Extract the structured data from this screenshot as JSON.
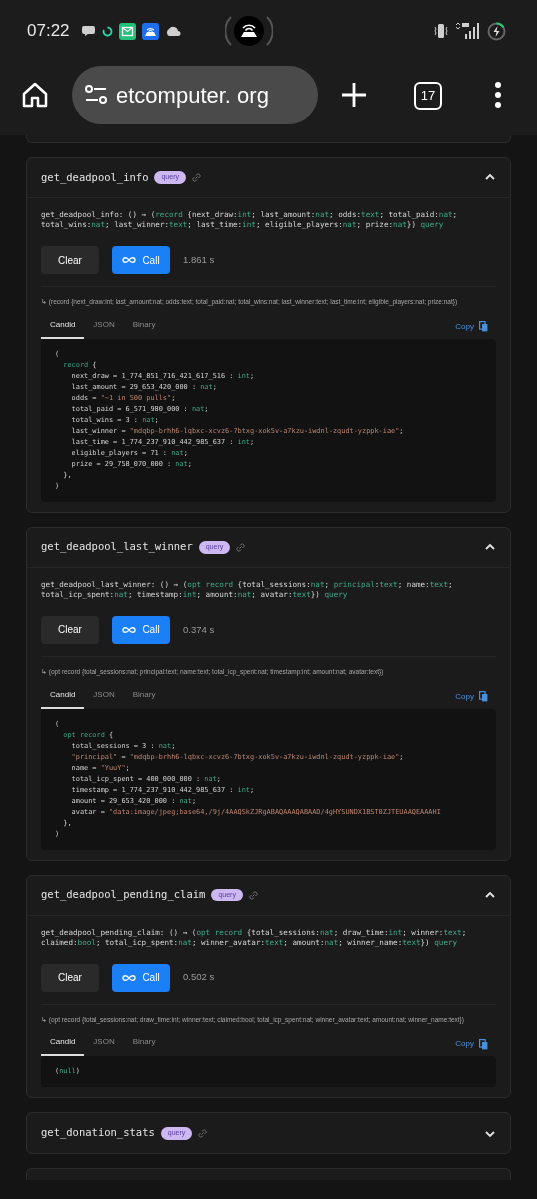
{
  "status_bar": {
    "time": "07:22"
  },
  "browser": {
    "url": "etcomputer. org",
    "tab_count": "17"
  },
  "methods": [
    {
      "name": "get_deadpool_info",
      "badge": "query",
      "expanded": true,
      "signature": [
        [
          {
            "text": "get_deadpool_info: () → (",
            "kind": "plain"
          },
          {
            "text": "record",
            "kind": "type"
          },
          {
            "text": " {next_draw:",
            "kind": "plain"
          },
          {
            "text": "int",
            "kind": "type"
          },
          {
            "text": "; last_amount:",
            "kind": "plain"
          },
          {
            "text": "nat",
            "kind": "type"
          },
          {
            "text": "; odds:",
            "kind": "plain"
          },
          {
            "text": "text",
            "kind": "type"
          },
          {
            "text": "; total_paid:",
            "kind": "plain"
          },
          {
            "text": "nat",
            "kind": "type"
          },
          {
            "text": ";",
            "kind": "plain"
          }
        ],
        [
          {
            "text": "total_wins:",
            "kind": "plain"
          },
          {
            "text": "nat",
            "kind": "type"
          },
          {
            "text": "; last_winner:",
            "kind": "plain"
          },
          {
            "text": "text",
            "kind": "type"
          },
          {
            "text": "; last_time:",
            "kind": "plain"
          },
          {
            "text": "int",
            "kind": "type"
          },
          {
            "text": "; eligible_players:",
            "kind": "plain"
          },
          {
            "text": "nat",
            "kind": "type"
          },
          {
            "text": "; prize:",
            "kind": "plain"
          },
          {
            "text": "nat",
            "kind": "type"
          },
          {
            "text": "}) ",
            "kind": "plain"
          },
          {
            "text": "query",
            "kind": "type"
          }
        ]
      ],
      "clear_button": "Clear",
      "call_button": "Call",
      "duration": "1.861 s",
      "return_type": "↳ (record {next_draw:int; last_amount:nat; odds:text; total_paid:nat; total_wins:nat; last_winner:text; last_time:int; eligible_players:nat; prize:nat})",
      "tabs": [
        {
          "label": "Candid",
          "selected": true
        },
        {
          "label": "JSON",
          "selected": false
        },
        {
          "label": "Binary",
          "selected": false
        }
      ],
      "copy": "Copy",
      "result": [
        [
          {
            "text": "(",
            "kind": "plain"
          }
        ],
        [
          {
            "text": "  record",
            "kind": "type"
          },
          {
            "text": " {",
            "kind": "plain"
          }
        ],
        [
          {
            "text": "    next_draw = 1_774_851_716_421_617_516 : ",
            "kind": "plain"
          },
          {
            "text": "int",
            "kind": "type"
          },
          {
            "text": ";",
            "kind": "plain"
          }
        ],
        [
          {
            "text": "    last_amount = 29_653_420_000 : ",
            "kind": "plain"
          },
          {
            "text": "nat",
            "kind": "type"
          },
          {
            "text": ";",
            "kind": "plain"
          }
        ],
        [
          {
            "text": "    odds = ",
            "kind": "plain"
          },
          {
            "text": "\"~1 in 500 pulls\"",
            "kind": "string"
          },
          {
            "text": ";",
            "kind": "plain"
          }
        ],
        [
          {
            "text": "    total_paid = 6_571_980_000 : ",
            "kind": "plain"
          },
          {
            "text": "nat",
            "kind": "type"
          },
          {
            "text": ";",
            "kind": "plain"
          }
        ],
        [
          {
            "text": "    total_wins = 3 : ",
            "kind": "plain"
          },
          {
            "text": "nat",
            "kind": "type"
          },
          {
            "text": ";",
            "kind": "plain"
          }
        ],
        [
          {
            "text": "    last_winner = ",
            "kind": "plain"
          },
          {
            "text": "\"mdqbp-brhh6-lqbxc-xcvz6-7btxg-xok5v-a7kzu-iwdnl-zqudt-yzppk-iae\"",
            "kind": "string"
          },
          {
            "text": ";",
            "kind": "plain"
          }
        ],
        [
          {
            "text": "    last_time = 1_774_237_910_442_985_637 : ",
            "kind": "plain"
          },
          {
            "text": "int",
            "kind": "type"
          },
          {
            "text": ";",
            "kind": "plain"
          }
        ],
        [
          {
            "text": "    eligible_players = 71 : ",
            "kind": "plain"
          },
          {
            "text": "nat",
            "kind": "type"
          },
          {
            "text": ";",
            "kind": "plain"
          }
        ],
        [
          {
            "text": "    prize = 29_758_070_000 : ",
            "kind": "plain"
          },
          {
            "text": "nat",
            "kind": "type"
          },
          {
            "text": ";",
            "kind": "plain"
          }
        ],
        [
          {
            "text": "  },",
            "kind": "plain"
          }
        ],
        [
          {
            "text": ")",
            "kind": "plain"
          }
        ]
      ]
    },
    {
      "name": "get_deadpool_last_winner",
      "badge": "query",
      "expanded": true,
      "signature": [
        [
          {
            "text": "get_deadpool_last_winner: () → (",
            "kind": "plain"
          },
          {
            "text": "opt record",
            "kind": "type"
          },
          {
            "text": " {total_sessions:",
            "kind": "plain"
          },
          {
            "text": "nat",
            "kind": "type"
          },
          {
            "text": "; ",
            "kind": "plain"
          },
          {
            "text": "principal",
            "kind": "type"
          },
          {
            "text": ":",
            "kind": "plain"
          },
          {
            "text": "text",
            "kind": "type"
          },
          {
            "text": "; name:",
            "kind": "plain"
          },
          {
            "text": "text",
            "kind": "type"
          },
          {
            "text": ";",
            "kind": "plain"
          }
        ],
        [
          {
            "text": "total_icp_spent:",
            "kind": "plain"
          },
          {
            "text": "nat",
            "kind": "type"
          },
          {
            "text": "; timestamp:",
            "kind": "plain"
          },
          {
            "text": "int",
            "kind": "type"
          },
          {
            "text": "; amount:",
            "kind": "plain"
          },
          {
            "text": "nat",
            "kind": "type"
          },
          {
            "text": "; avatar:",
            "kind": "plain"
          },
          {
            "text": "text",
            "kind": "type"
          },
          {
            "text": "}) ",
            "kind": "plain"
          },
          {
            "text": "query",
            "kind": "type"
          }
        ]
      ],
      "clear_button": "Clear",
      "call_button": "Call",
      "duration": "0.374 s",
      "return_type": "↳ (opt record {total_sessions:nat; principal:text; name:text; total_icp_spent:nat; timestamp:int; amount:nat; avatar:text})",
      "tabs": [
        {
          "label": "Candid",
          "selected": true
        },
        {
          "label": "JSON",
          "selected": false
        },
        {
          "label": "Binary",
          "selected": false
        }
      ],
      "copy": "Copy",
      "result": [
        [
          {
            "text": "(",
            "kind": "plain"
          }
        ],
        [
          {
            "text": "  opt record",
            "kind": "type"
          },
          {
            "text": " {",
            "kind": "plain"
          }
        ],
        [
          {
            "text": "    total_sessions = 3 : ",
            "kind": "plain"
          },
          {
            "text": "nat",
            "kind": "type"
          },
          {
            "text": ";",
            "kind": "plain"
          }
        ],
        [
          {
            "text": "    \"principal\"",
            "kind": "string"
          },
          {
            "text": " = ",
            "kind": "plain"
          },
          {
            "text": "\"mdqbp-brhh6-lqbxc-xcvz6-7btxg-xok5v-a7kzu-iwdnl-zqudt-yzppk-iae\"",
            "kind": "string"
          },
          {
            "text": ";",
            "kind": "plain"
          }
        ],
        [
          {
            "text": "    name = ",
            "kind": "plain"
          },
          {
            "text": "\"YuuY\"",
            "kind": "string"
          },
          {
            "text": ";",
            "kind": "plain"
          }
        ],
        [
          {
            "text": "    total_icp_spent = 400_000_000 : ",
            "kind": "plain"
          },
          {
            "text": "nat",
            "kind": "type"
          },
          {
            "text": ";",
            "kind": "plain"
          }
        ],
        [
          {
            "text": "    timestamp = 1_774_237_910_442_985_637 : ",
            "kind": "plain"
          },
          {
            "text": "int",
            "kind": "type"
          },
          {
            "text": ";",
            "kind": "plain"
          }
        ],
        [
          {
            "text": "    amount = 29_653_420_000 : ",
            "kind": "plain"
          },
          {
            "text": "nat",
            "kind": "type"
          },
          {
            "text": ";",
            "kind": "plain"
          }
        ],
        [
          {
            "text": "    avatar = ",
            "kind": "plain"
          },
          {
            "text": "\"data:image/jpeg;base64,/9j/4AAQSkZJRgABAQAAAQABAAD/4gHYSUNDX1BST0ZJTEUAAQEAAAHI",
            "kind": "string"
          }
        ],
        [
          {
            "text": "  },",
            "kind": "plain"
          }
        ],
        [
          {
            "text": ")",
            "kind": "plain"
          }
        ]
      ]
    },
    {
      "name": "get_deadpool_pending_claim",
      "badge": "query",
      "expanded": true,
      "signature": [
        [
          {
            "text": "get_deadpool_pending_claim: () → (",
            "kind": "plain"
          },
          {
            "text": "opt record",
            "kind": "type"
          },
          {
            "text": " {total_sessions:",
            "kind": "plain"
          },
          {
            "text": "nat",
            "kind": "type"
          },
          {
            "text": "; draw_time:",
            "kind": "plain"
          },
          {
            "text": "int",
            "kind": "type"
          },
          {
            "text": "; winner:",
            "kind": "plain"
          },
          {
            "text": "text",
            "kind": "type"
          },
          {
            "text": ";",
            "kind": "plain"
          }
        ],
        [
          {
            "text": "claimed:",
            "kind": "plain"
          },
          {
            "text": "bool",
            "kind": "type"
          },
          {
            "text": "; total_icp_spent:",
            "kind": "plain"
          },
          {
            "text": "nat",
            "kind": "type"
          },
          {
            "text": "; winner_avatar:",
            "kind": "plain"
          },
          {
            "text": "text",
            "kind": "type"
          },
          {
            "text": "; amount:",
            "kind": "plain"
          },
          {
            "text": "nat",
            "kind": "type"
          },
          {
            "text": "; winner_name:",
            "kind": "plain"
          },
          {
            "text": "text",
            "kind": "type"
          },
          {
            "text": "}) ",
            "kind": "plain"
          },
          {
            "text": "query",
            "kind": "type"
          }
        ]
      ],
      "clear_button": "Clear",
      "call_button": "Call",
      "duration": "0.502 s",
      "return_type": "↳ (opt record {total_sessions:nat; draw_time:int; winner:text; claimed:bool; total_icp_spent:nat; winner_avatar:text; amount:nat; winner_name:text})",
      "tabs": [
        {
          "label": "Candid",
          "selected": true
        },
        {
          "label": "JSON",
          "selected": false
        },
        {
          "label": "Binary",
          "selected": false
        }
      ],
      "copy": "Copy",
      "result": [
        [
          {
            "text": "(",
            "kind": "plain"
          },
          {
            "text": "null",
            "kind": "type"
          },
          {
            "text": ")",
            "kind": "plain"
          }
        ]
      ]
    },
    {
      "name": "get_donation_stats",
      "badge": "query",
      "expanded": false
    }
  ]
}
